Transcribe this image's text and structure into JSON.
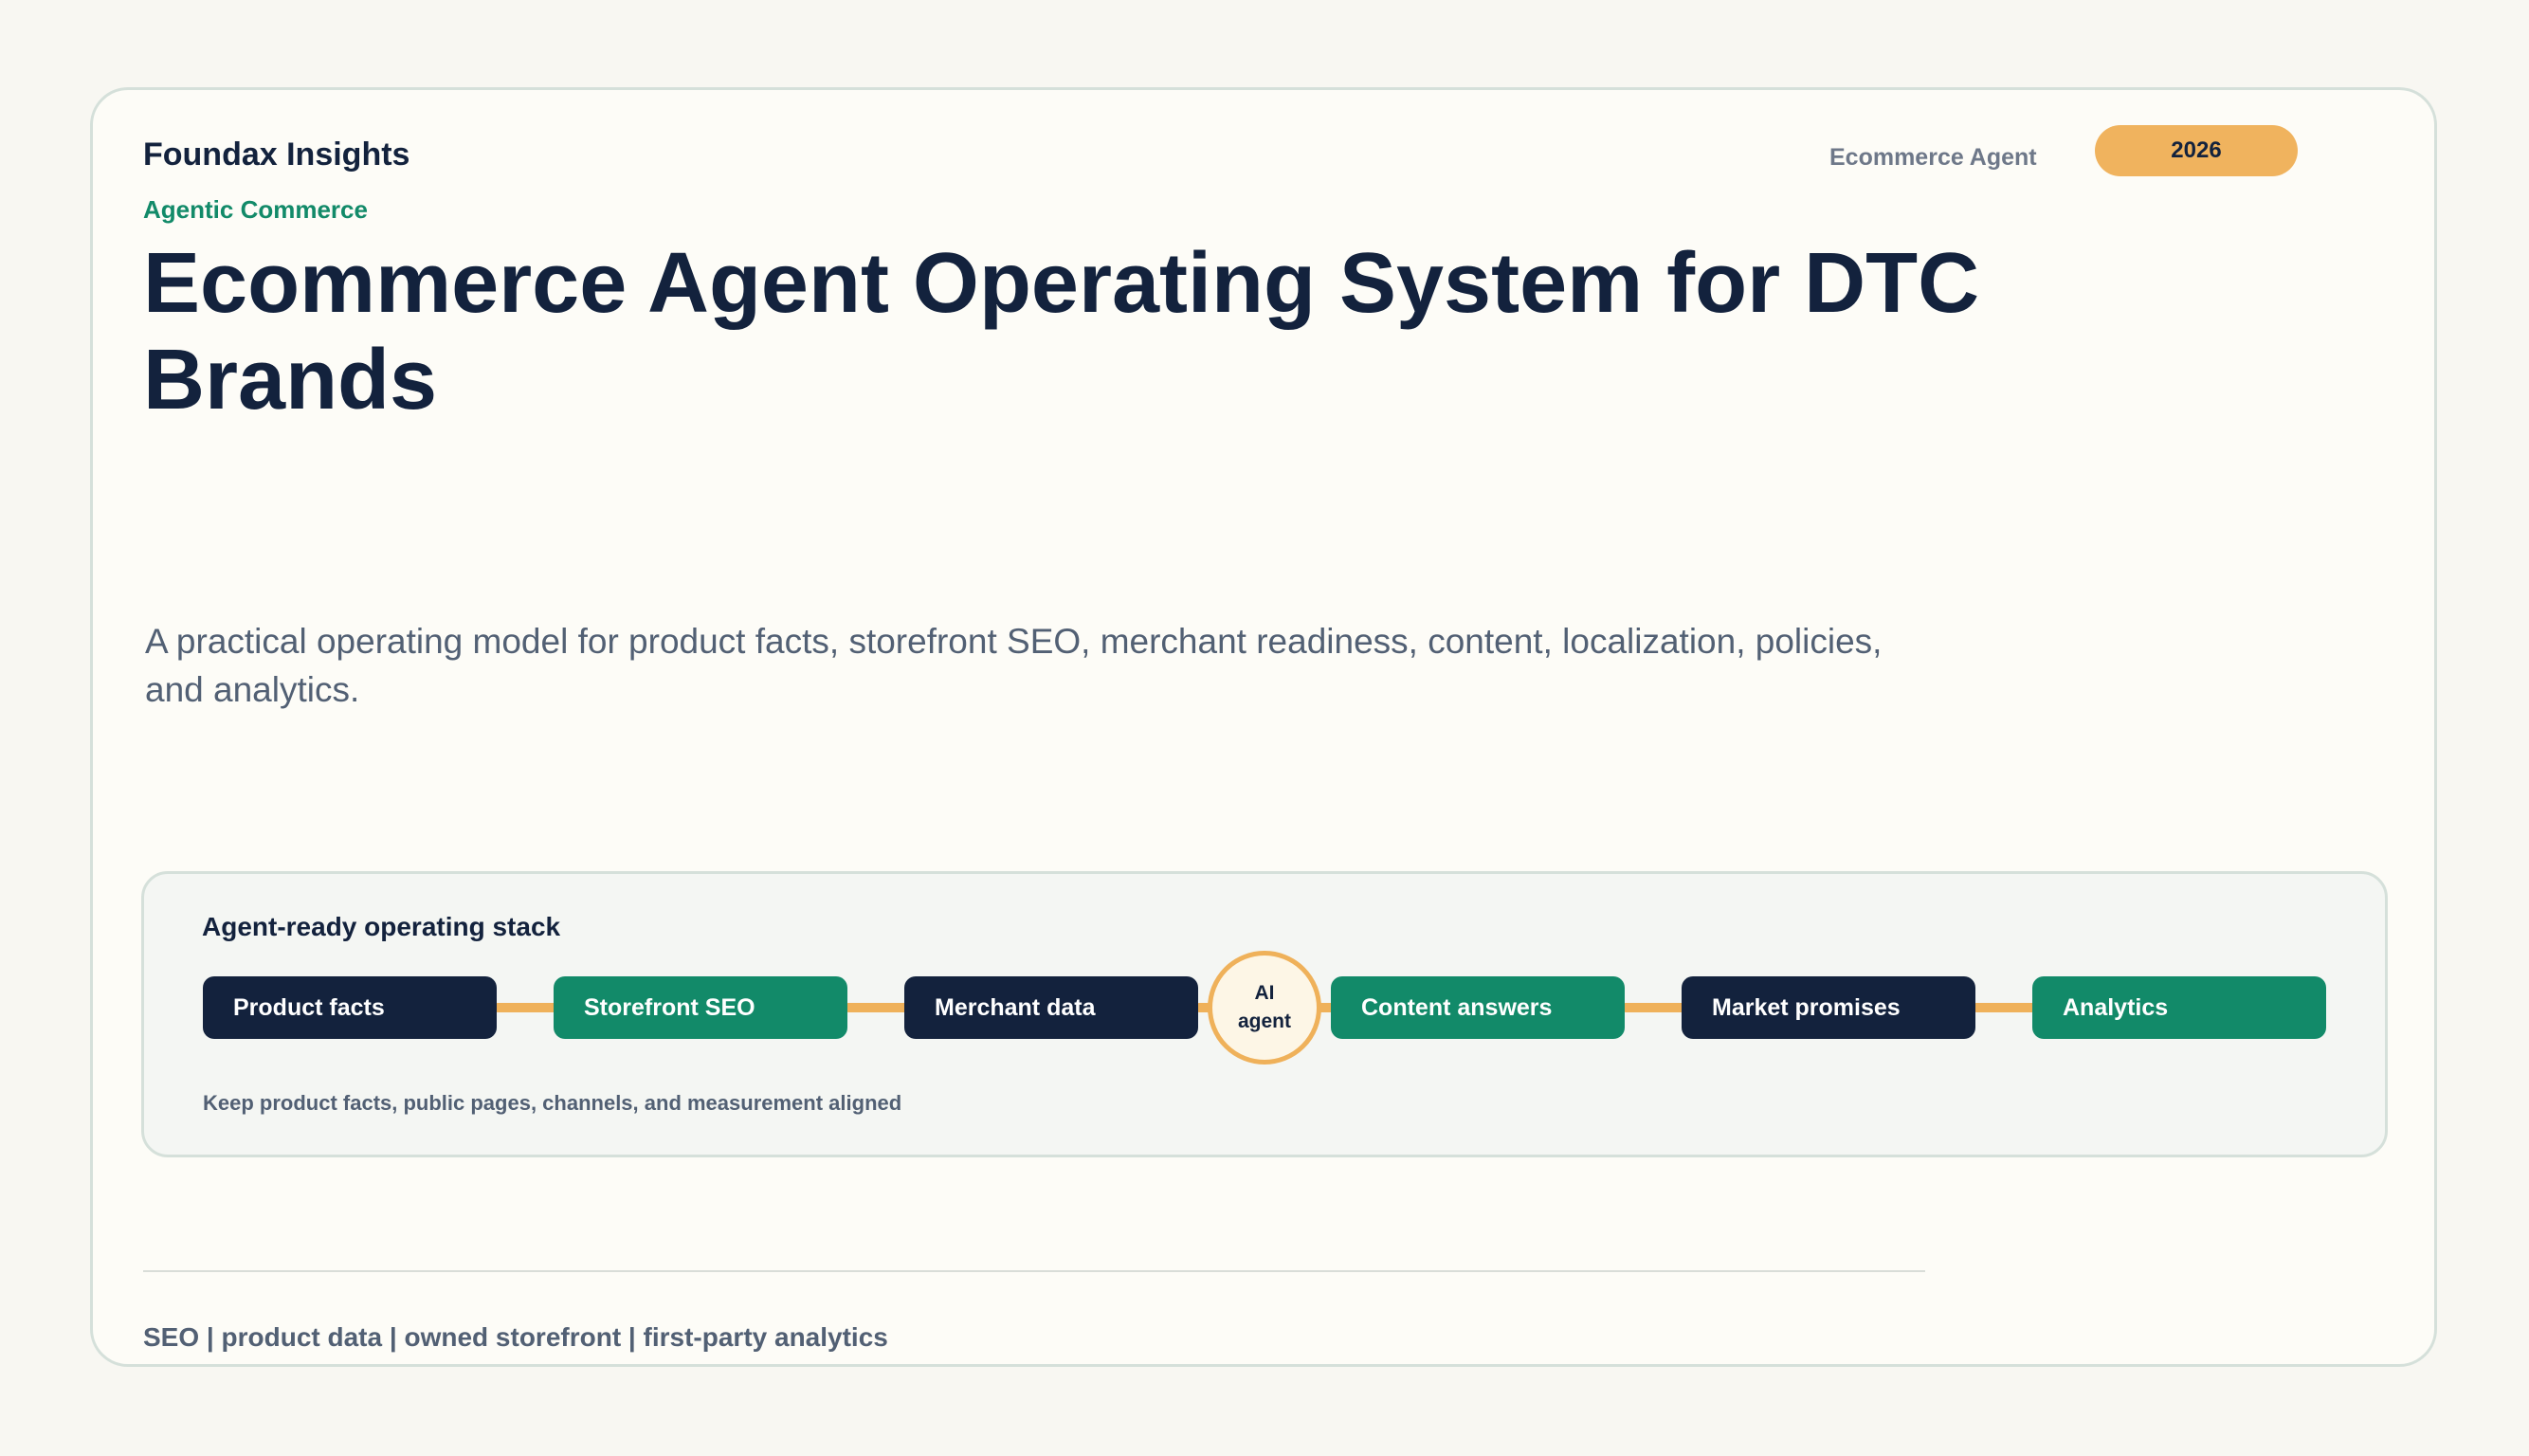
{
  "header": {
    "brand": "Foundax Insights",
    "kicker": "Agentic Commerce",
    "top_label": "Ecommerce Agent",
    "year": "2026"
  },
  "hero": {
    "title": "Ecommerce Agent Operating System for DTC Brands",
    "subtitle": "A practical operating model for product facts, storefront SEO, merchant readiness, content, localization, policies, and analytics."
  },
  "stack": {
    "title": "Agent-ready operating stack",
    "nodes": [
      {
        "label": "Product facts",
        "tone": "dark"
      },
      {
        "label": "Storefront SEO",
        "tone": "green"
      },
      {
        "label": "Merchant data",
        "tone": "dark"
      },
      {
        "label": "Content answers",
        "tone": "green"
      },
      {
        "label": "Market promises",
        "tone": "dark"
      },
      {
        "label": "Analytics",
        "tone": "green"
      }
    ],
    "hub": {
      "line1": "AI",
      "line2": "agent"
    },
    "note": "Keep product facts, public pages, channels, and measurement aligned"
  },
  "footer": {
    "text": "SEO | product data | owned storefront | first-party analytics"
  },
  "colors": {
    "navy": "#13223d",
    "green": "#128a69",
    "accent": "#f0b35e"
  }
}
